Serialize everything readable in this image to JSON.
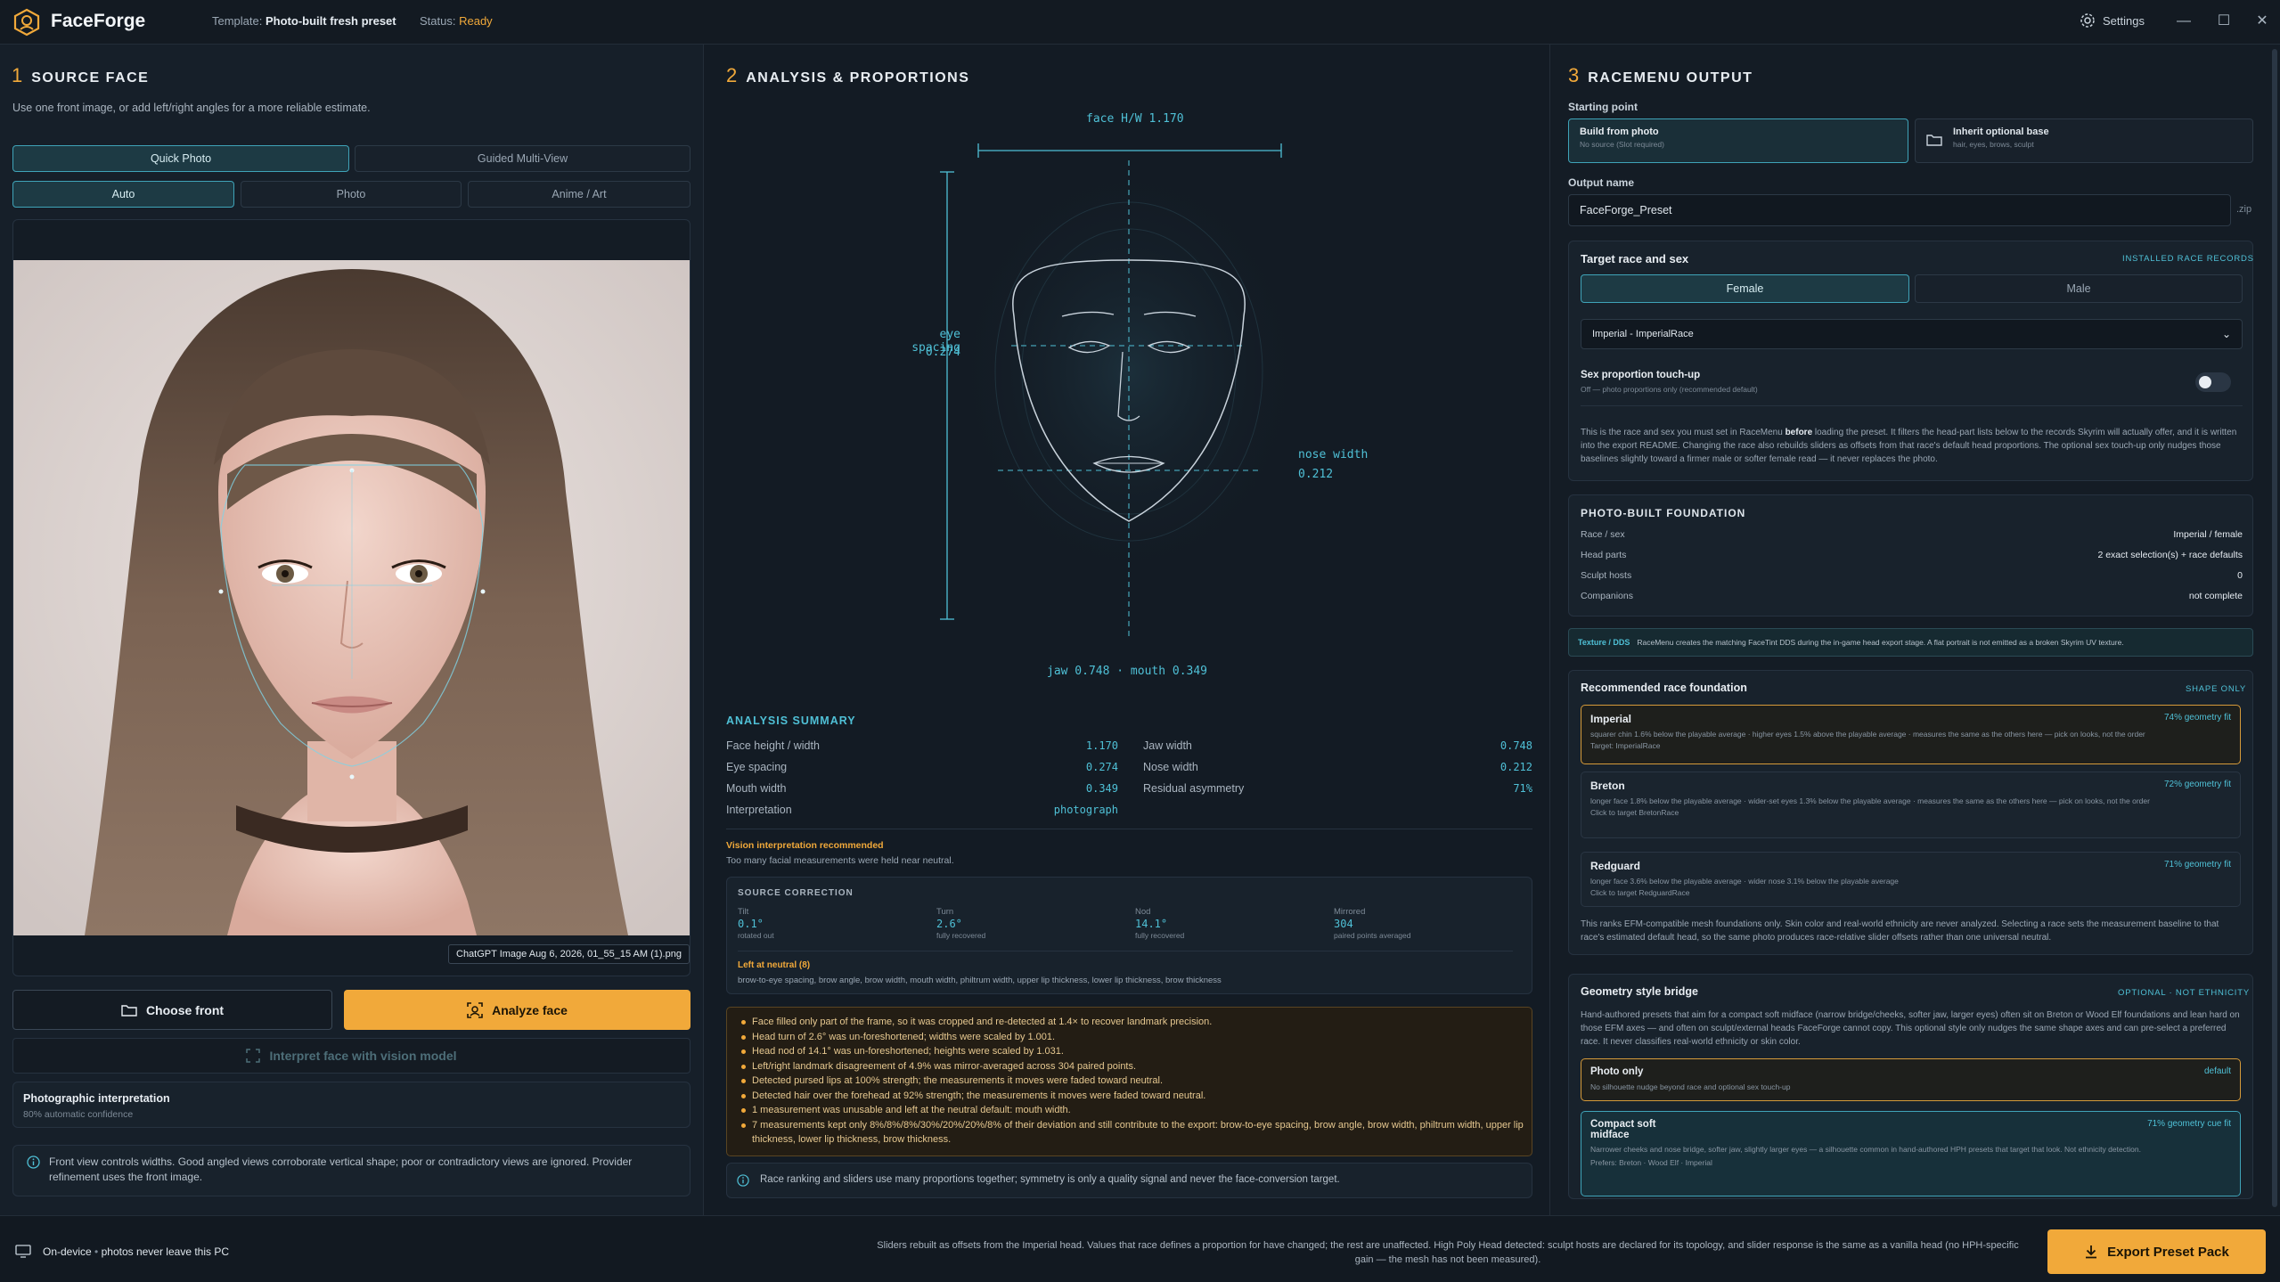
{
  "app": {
    "name": "FaceForge",
    "template_label": "Template:",
    "template_value": "Photo-built fresh preset",
    "status_label": "Status:",
    "status_value": "Ready",
    "settings_label": "Settings",
    "minimize": "—",
    "maximize": "☐",
    "close": "✕"
  },
  "source": {
    "num": "1",
    "title": "SOURCE FACE",
    "subtitle": "Use one front image, or add left/right angles for a more reliable estimate.",
    "mode_tabs": [
      "Quick Photo",
      "Guided Multi-View"
    ],
    "style_tabs": [
      "Auto",
      "Photo",
      "Anime / Art"
    ],
    "filename": "ChatGPT Image Aug 6, 2026, 01_55_15 AM (1).png",
    "choose_front": "Choose front",
    "analyze": "Analyze face",
    "interpret": "Interpret face with vision model",
    "interp_title": "Photographic interpretation",
    "interp_conf": "80% automatic confidence",
    "info_text": "Front view controls widths. Good angled views corroborate vertical shape; poor or contradictory views are ignored. Provider refinement uses the front image."
  },
  "analysis": {
    "num": "2",
    "title": "ANALYSIS & PROPORTIONS",
    "diagram": {
      "face_hw": "face H/W 1.170",
      "eye_spacing": "eye spacing",
      "eye_spacing_val": "0.274",
      "nose_width": "nose width",
      "nose_width_val": "0.212",
      "jaw_mouth": "jaw 0.748 · mouth 0.349"
    },
    "summary_title": "ANALYSIS SUMMARY",
    "summary_left": [
      {
        "label": "Face height / width",
        "value": "1.170"
      },
      {
        "label": "Eye spacing",
        "value": "0.274"
      },
      {
        "label": "Mouth width",
        "value": "0.349"
      },
      {
        "label": "Interpretation",
        "value": "photograph"
      }
    ],
    "summary_right": [
      {
        "label": "Jaw width",
        "value": "0.748"
      },
      {
        "label": "Nose width",
        "value": "0.212"
      },
      {
        "label": "Residual asymmetry",
        "value": "71%"
      }
    ],
    "vision_title": "Vision interpretation recommended",
    "vision_text": "Too many facial measurements were held near neutral.",
    "correction_title": "SOURCE CORRECTION",
    "corrections": [
      {
        "label": "Tilt",
        "value": "0.1°",
        "note": "rotated out"
      },
      {
        "label": "Turn",
        "value": "2.6°",
        "note": "fully recovered"
      },
      {
        "label": "Nod",
        "value": "14.1°",
        "note": "fully recovered"
      },
      {
        "label": "Mirrored",
        "value": "304",
        "note": "paired points averaged"
      }
    ],
    "neutral_title": "Left at neutral (8)",
    "neutral_text": "brow-to-eye spacing, brow angle, brow width, mouth width, philtrum width, upper lip thickness, lower lip thickness, brow thickness",
    "warnings": [
      "Face filled only part of the frame, so it was cropped and re-detected at 1.4× to recover landmark precision.",
      "Head turn of 2.6° was un-foreshortened; widths were scaled by 1.001.",
      "Head nod of 14.1° was un-foreshortened; heights were scaled by 1.031.",
      "Left/right landmark disagreement of 4.9% was mirror-averaged across 304 paired points.",
      "Detected pursed lips at 100% strength; the measurements it moves were faded toward neutral.",
      "Detected hair over the forehead at 92% strength; the measurements it moves were faded toward neutral.",
      "1 measurement was unusable and left at the neutral default: mouth width.",
      "7 measurements kept only 8%/8%/8%/30%/20%/20%/8% of their deviation and still contribute to the export: brow-to-eye spacing, brow angle, brow width, philtrum width, upper lip thickness, lower lip thickness, brow thickness."
    ],
    "footnote": "Race ranking and sliders use many proportions together; symmetry is only a quality signal and never the face-conversion target."
  },
  "output": {
    "num": "3",
    "title": "RACEMENU OUTPUT",
    "starting_point": "Starting point",
    "build_title": "Build from photo",
    "build_sub": "No source (Slot required)",
    "inherit_title": "Inherit optional base",
    "inherit_sub": "hair, eyes, brows, sculpt",
    "output_name_label": "Output name",
    "output_name": "FaceForge_Preset",
    "zip": ".zip",
    "target_title": "Target race and sex",
    "installed": "INSTALLED RACE RECORDS",
    "sex_options": [
      "Female",
      "Male"
    ],
    "race_select": "Imperial - ImperialRace",
    "touchup_title": "Sex proportion touch-up",
    "touchup_sub": "Off — photo proportions only (recommended default)",
    "target_desc_pre": "This is the race and sex you must set in RaceMenu ",
    "target_desc_bold": "before",
    "target_desc_post": " loading the preset. It filters the head-part lists below to the records Skyrim will actually offer, and it is written into the export README. Changing the race also rebuilds sliders as offsets from that race's default head proportions. The optional sex touch-up only nudges those baselines slightly toward a firmer male or softer female read — it never replaces the photo.",
    "foundation_title": "PHOTO-BUILT FOUNDATION",
    "foundation": [
      {
        "k": "Race / sex",
        "v": "Imperial / female"
      },
      {
        "k": "Head parts",
        "v": "2 exact selection(s) + race defaults"
      },
      {
        "k": "Sculpt hosts",
        "v": "0"
      },
      {
        "k": "Companions",
        "v": "not complete"
      }
    ],
    "texture_label": "Texture / DDS",
    "texture_text": "RaceMenu creates the matching FaceTint DDS during the in-game head export stage. A flat portrait is not emitted as a broken Skyrim UV texture.",
    "rec_title": "Recommended race foundation",
    "rec_tag": "SHAPE ONLY",
    "races": [
      {
        "name": "Imperial",
        "fit": "74% geometry fit",
        "desc": "squarer chin 1.6% below the playable average · higher eyes 1.5% above the playable average · measures the same as the others here — pick on looks, not the order",
        "target": "Target: ImperialRace",
        "selected": true
      },
      {
        "name": "Breton",
        "fit": "72% geometry fit",
        "desc": "longer face 1.8% below the playable average · wider-set eyes 1.3% below the playable average · measures the same as the others here — pick on looks, not the order",
        "target": "Click to target BretonRace",
        "selected": false
      },
      {
        "name": "Redguard",
        "fit": "71% geometry fit",
        "desc": "longer face 3.6% below the playable average · wider nose 3.1% below the playable average",
        "target": "Click to target RedguardRace",
        "selected": false
      }
    ],
    "rec_note": "This ranks EFM-compatible mesh foundations only. Skin color and real-world ethnicity are never analyzed. Selecting a race sets the measurement baseline to that race's estimated default head, so the same photo produces race-relative slider offsets rather than one universal neutral.",
    "geo_title": "Geometry style bridge",
    "geo_tag": "OPTIONAL · NOT ETHNICITY",
    "geo_desc": "Hand-authored presets that aim for a compact soft midface (narrow bridge/cheeks, softer jaw, larger eyes) often sit on Breton or Wood Elf foundations and lean hard on those EFM axes — and often on sculpt/external heads FaceForge cannot copy. This optional style only nudges the same shape axes and can pre-select a preferred race. It never classifies real-world ethnicity or skin color.",
    "photo_only_title": "Photo only",
    "photo_only_tag": "default",
    "photo_only_sub": "No silhouette nudge beyond race and optional sex touch-up",
    "compact_title": "Compact soft midface",
    "compact_fit": "71% geometry cue fit",
    "compact_desc": "Narrower cheeks and nose bridge, softer jaw, slightly larger eyes — a silhouette common in hand-authored HPH presets that target that look. Not ethnicity detection.",
    "compact_prefers": "Prefers: Breton · Wood Elf · Imperial"
  },
  "footer": {
    "device_label": "On-device",
    "device_text": "photos never leave this PC",
    "note": "Sliders rebuilt as offsets from the Imperial head. Values that race defines a proportion for have changed; the rest are unaffected. High Poly Head detected: sculpt hosts are declared for its topology, and slider response is the same as a vanilla head (no HPH-specific gain — the mesh has not been measured).",
    "export": "Export Preset Pack"
  },
  "colors": {
    "accent": "#f1a93a",
    "teal": "#4fc0d6",
    "bg": "#131a22"
  }
}
